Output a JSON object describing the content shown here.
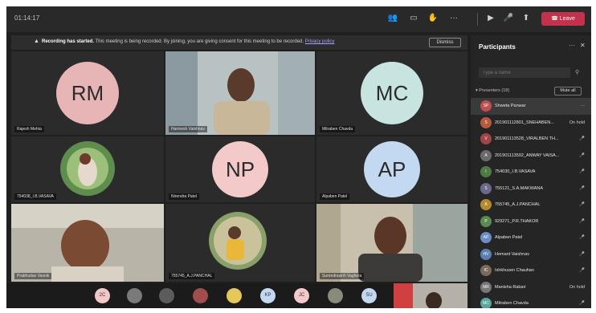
{
  "topbar": {
    "timer": "01:14:17",
    "leave_label": "Leave",
    "icons": [
      "participants-icon",
      "chat-icon",
      "raise-hand-icon",
      "more-icon",
      "camera-icon",
      "mic-icon",
      "share-icon",
      "phone-icon"
    ]
  },
  "banner": {
    "bold": "Recording has started.",
    "text": " This meeting is being recorded. By joining, you are giving consent for this meeting to be recorded. ",
    "link": "Privacy policy",
    "dismiss": "Dismiss"
  },
  "tiles": [
    {
      "type": "initials",
      "initials": "RM",
      "color": "#e8b5b7",
      "name": "Rajesh Mehta"
    },
    {
      "type": "video",
      "name": "Harmesh Vaishnav"
    },
    {
      "type": "initials",
      "initials": "MC",
      "color": "#c8e4e1",
      "name": "Mitraben Chavda"
    },
    {
      "type": "video",
      "name": "754038_I.B.VASAVA"
    },
    {
      "type": "initials",
      "initials": "NP",
      "color": "#f3c9c9",
      "name": "Nirendra Patel"
    },
    {
      "type": "initials",
      "initials": "AP",
      "color": "#c3d8f1",
      "name": "Alpaben Patel"
    },
    {
      "type": "video",
      "name": "Prabhudas Vasnik"
    },
    {
      "type": "video",
      "name": "755745_A.J.PANCHAL"
    },
    {
      "type": "video",
      "name": "Surendrasinh Vaghela"
    }
  ],
  "panel": {
    "title": "Participants",
    "search_placeholder": "Type a name",
    "presenters": "Presenters (18)",
    "mute_all": "Mute all",
    "participants": [
      {
        "name": "Shweta Panwar",
        "status": "···",
        "initials": "SP",
        "color": "#c0504d"
      },
      {
        "name": "201901112801_SNEHABEN...",
        "status": "On hold",
        "initials": "S",
        "color": "#b55a3c"
      },
      {
        "name": "201901113528_VIRALBEN TH...",
        "status": "🎤",
        "initials": "V",
        "color": "#a04646"
      },
      {
        "name": "201901113592_ANWAY VAISA...",
        "status": "🎤",
        "initials": "A",
        "color": "#6b6b6b"
      },
      {
        "name": "754030_I.B.VASAVA",
        "status": "🎤",
        "initials": "I",
        "color": "#4f7a43"
      },
      {
        "name": "755121_S.A.MAKWANA",
        "status": "🎤",
        "initials": "S",
        "color": "#6a6a8a"
      },
      {
        "name": "755745_A.J.PANCHAL",
        "status": "🎤",
        "initials": "A",
        "color": "#b38a2e"
      },
      {
        "name": "929271_P.R.THAKOR",
        "status": "🎤",
        "initials": "P",
        "color": "#5b8a4f"
      },
      {
        "name": "Alpaben Patel",
        "status": "🎤",
        "initials": "AP",
        "color": "#6b8cc4"
      },
      {
        "name": "Hemant Vaishnav",
        "status": "🎤",
        "initials": "HV",
        "color": "#5a7fb0"
      },
      {
        "name": "Ishkhusen Chauhan",
        "status": "🎤",
        "initials": "IC",
        "color": "#7a6a5a"
      },
      {
        "name": "Manisha Rabari",
        "status": "On hold",
        "initials": "MR",
        "color": "#777777"
      },
      {
        "name": "Mitraben Chavda",
        "status": "🎤",
        "initials": "MC",
        "color": "#5aa59a"
      }
    ]
  },
  "strip": [
    {
      "label": "2C",
      "color": "#f2c7c7"
    },
    {
      "label": "",
      "color": "#7a7a7a"
    },
    {
      "label": "",
      "color": "#5c5c5c"
    },
    {
      "label": "",
      "color": "#a14d4d"
    },
    {
      "label": "",
      "color": "#e6c75a"
    },
    {
      "label": "KP",
      "color": "#c3d8f1"
    },
    {
      "label": "JC",
      "color": "#f3c9c9"
    },
    {
      "label": "",
      "color": "#8a8a7a"
    },
    {
      "label": "SU",
      "color": "#c3d8f1"
    }
  ]
}
